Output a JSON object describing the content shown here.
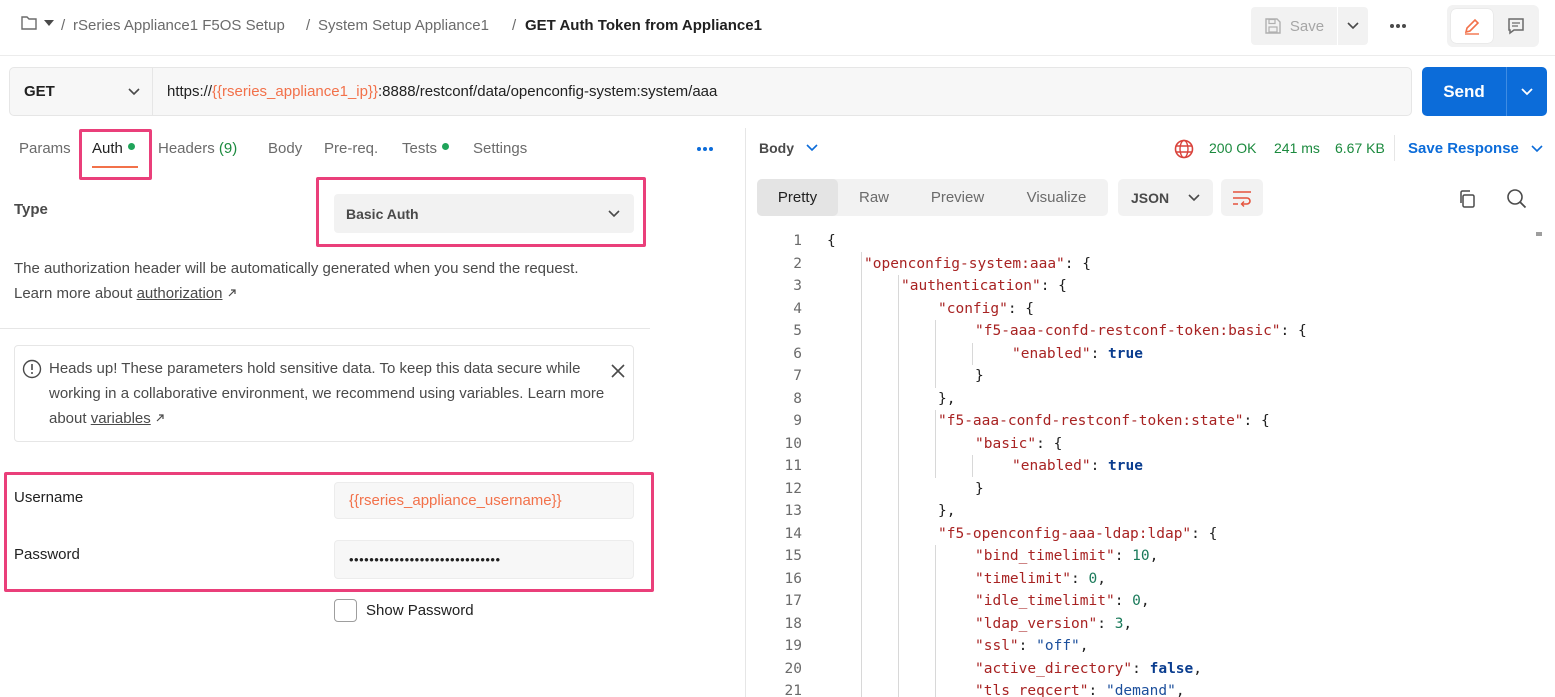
{
  "breadcrumb": {
    "items": [
      "rSeries Appliance1 F5OS Setup",
      "System Setup Appliance1"
    ],
    "current": "GET Auth Token from Appliance1",
    "separator": "/"
  },
  "toolbar": {
    "save_label": "Save"
  },
  "request": {
    "method": "GET",
    "url_prefix": "https://",
    "url_variable": "{{rseries_appliance1_ip}}",
    "url_suffix": ":8888/restconf/data/openconfig-system:system/aaa",
    "send_label": "Send"
  },
  "request_tabs": {
    "params": "Params",
    "auth": "Auth",
    "headers": "Headers",
    "headers_count": "(9)",
    "body": "Body",
    "prereq": "Pre-req.",
    "tests": "Tests",
    "settings": "Settings"
  },
  "auth": {
    "type_label": "Type",
    "type_value": "Basic Auth",
    "description": "The authorization header will be automatically generated when you send the request. Learn more about ",
    "description_link": "authorization",
    "alert_text": "Heads up! These parameters hold sensitive data. To keep this data secure while working in a collaborative environment, we recommend using variables. Learn more about ",
    "alert_link": "variables",
    "username_label": "Username",
    "username_value": "{{rseries_appliance_username}}",
    "password_label": "Password",
    "password_value": "••••••••••••••••••••••••••••••",
    "show_password_label": "Show Password"
  },
  "response": {
    "body_label": "Body",
    "status": "200 OK",
    "time": "241 ms",
    "size": "6.67 KB",
    "save_response_label": "Save Response",
    "view_tabs": [
      "Pretty",
      "Raw",
      "Preview",
      "Visualize"
    ],
    "format": "JSON",
    "lines": [
      {
        "n": "1",
        "indent": 0,
        "parts": [
          [
            "p",
            "{"
          ]
        ]
      },
      {
        "n": "2",
        "indent": 1,
        "parts": [
          [
            "k",
            "\"openconfig-system:aaa\""
          ],
          [
            "p",
            ": {"
          ]
        ]
      },
      {
        "n": "3",
        "indent": 2,
        "parts": [
          [
            "k",
            "\"authentication\""
          ],
          [
            "p",
            ": {"
          ]
        ]
      },
      {
        "n": "4",
        "indent": 3,
        "parts": [
          [
            "k",
            "\"config\""
          ],
          [
            "p",
            ": {"
          ]
        ]
      },
      {
        "n": "5",
        "indent": 4,
        "parts": [
          [
            "k",
            "\"f5-aaa-confd-restconf-token:basic\""
          ],
          [
            "p",
            ": {"
          ]
        ]
      },
      {
        "n": "6",
        "indent": 5,
        "parts": [
          [
            "k",
            "\"enabled\""
          ],
          [
            "p",
            ": "
          ],
          [
            "b",
            "true"
          ]
        ]
      },
      {
        "n": "7",
        "indent": 4,
        "parts": [
          [
            "p",
            "}"
          ]
        ]
      },
      {
        "n": "8",
        "indent": 3,
        "parts": [
          [
            "p",
            "},"
          ]
        ]
      },
      {
        "n": "9",
        "indent": 3,
        "parts": [
          [
            "k",
            "\"f5-aaa-confd-restconf-token:state\""
          ],
          [
            "p",
            ": {"
          ]
        ]
      },
      {
        "n": "10",
        "indent": 4,
        "parts": [
          [
            "k",
            "\"basic\""
          ],
          [
            "p",
            ": {"
          ]
        ]
      },
      {
        "n": "11",
        "indent": 5,
        "parts": [
          [
            "k",
            "\"enabled\""
          ],
          [
            "p",
            ": "
          ],
          [
            "b",
            "true"
          ]
        ]
      },
      {
        "n": "12",
        "indent": 4,
        "parts": [
          [
            "p",
            "}"
          ]
        ]
      },
      {
        "n": "13",
        "indent": 3,
        "parts": [
          [
            "p",
            "},"
          ]
        ]
      },
      {
        "n": "14",
        "indent": 3,
        "parts": [
          [
            "k",
            "\"f5-openconfig-aaa-ldap:ldap\""
          ],
          [
            "p",
            ": {"
          ]
        ]
      },
      {
        "n": "15",
        "indent": 4,
        "parts": [
          [
            "k",
            "\"bind_timelimit\""
          ],
          [
            "p",
            ": "
          ],
          [
            "n",
            "10"
          ],
          [
            "p",
            ","
          ]
        ]
      },
      {
        "n": "16",
        "indent": 4,
        "parts": [
          [
            "k",
            "\"timelimit\""
          ],
          [
            "p",
            ": "
          ],
          [
            "n",
            "0"
          ],
          [
            "p",
            ","
          ]
        ]
      },
      {
        "n": "17",
        "indent": 4,
        "parts": [
          [
            "k",
            "\"idle_timelimit\""
          ],
          [
            "p",
            ": "
          ],
          [
            "n",
            "0"
          ],
          [
            "p",
            ","
          ]
        ]
      },
      {
        "n": "18",
        "indent": 4,
        "parts": [
          [
            "k",
            "\"ldap_version\""
          ],
          [
            "p",
            ": "
          ],
          [
            "n",
            "3"
          ],
          [
            "p",
            ","
          ]
        ]
      },
      {
        "n": "19",
        "indent": 4,
        "parts": [
          [
            "k",
            "\"ssl\""
          ],
          [
            "p",
            ": "
          ],
          [
            "s",
            "\"off\""
          ],
          [
            "p",
            ","
          ]
        ]
      },
      {
        "n": "20",
        "indent": 4,
        "parts": [
          [
            "k",
            "\"active_directory\""
          ],
          [
            "p",
            ": "
          ],
          [
            "b",
            "false"
          ],
          [
            "p",
            ","
          ]
        ]
      },
      {
        "n": "21",
        "indent": 4,
        "parts": [
          [
            "k",
            "\"tls_reqcert\""
          ],
          [
            "p",
            ": "
          ],
          [
            "s",
            "\"demand\""
          ],
          [
            "p",
            ","
          ]
        ]
      }
    ]
  },
  "colors": {
    "accent_orange": "#f2714a",
    "highlight_pink": "#ea3f7a",
    "send_blue": "#0c6cd9",
    "status_green": "#1b8a3e"
  }
}
